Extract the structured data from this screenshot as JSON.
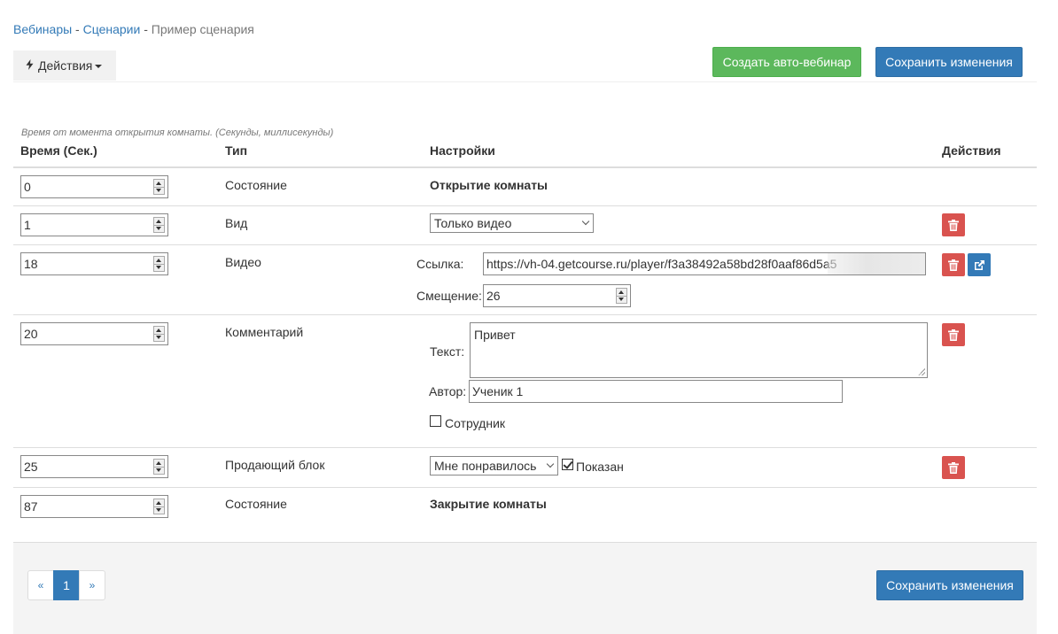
{
  "breadcrumb": {
    "items": [
      "Вебинары",
      "Сценарии"
    ],
    "separator": "-",
    "current": "Пример сценария"
  },
  "toolbar": {
    "actions_label": "Действия",
    "create_auto_webinar": "Создать авто-вебинар",
    "save_changes": "Сохранить изменения"
  },
  "table": {
    "hint": "Время от момента открытия комнаты. (Секунды, миллисекунды)",
    "headers": {
      "time": "Время (Сек.)",
      "type": "Тип",
      "settings": "Настройки",
      "actions": "Действия"
    },
    "rows": [
      {
        "time": "0",
        "type": "Состояние",
        "setting": "Открытие комнаты"
      },
      {
        "time": "1",
        "type": "Вид",
        "select": "Только видео"
      },
      {
        "time": "18",
        "type": "Видео",
        "link_label": "Ссылка:",
        "link": "https://vh-04.getcourse.ru/player/f3a38492a58bd28f0aaf86d5a5",
        "offset_label": "Смещение:",
        "offset": "26"
      },
      {
        "time": "20",
        "type": "Комментарий",
        "text_label": "Текст:",
        "text": "Привет",
        "author_label": "Автор:",
        "author": "Ученик 1",
        "employee_label": "Сотрудник",
        "employee": false
      },
      {
        "time": "25",
        "type": "Продающий блок",
        "select": "Мне понравилось",
        "shown_label": "Показан",
        "shown": true
      },
      {
        "time": "87",
        "type": "Состояние",
        "setting": "Закрытие комнаты"
      }
    ]
  },
  "pagination": {
    "prev": "«",
    "current": "1",
    "next": "»"
  },
  "colors": {
    "primary": "#337ab7",
    "success": "#5cb85c",
    "danger": "#d9534f"
  }
}
